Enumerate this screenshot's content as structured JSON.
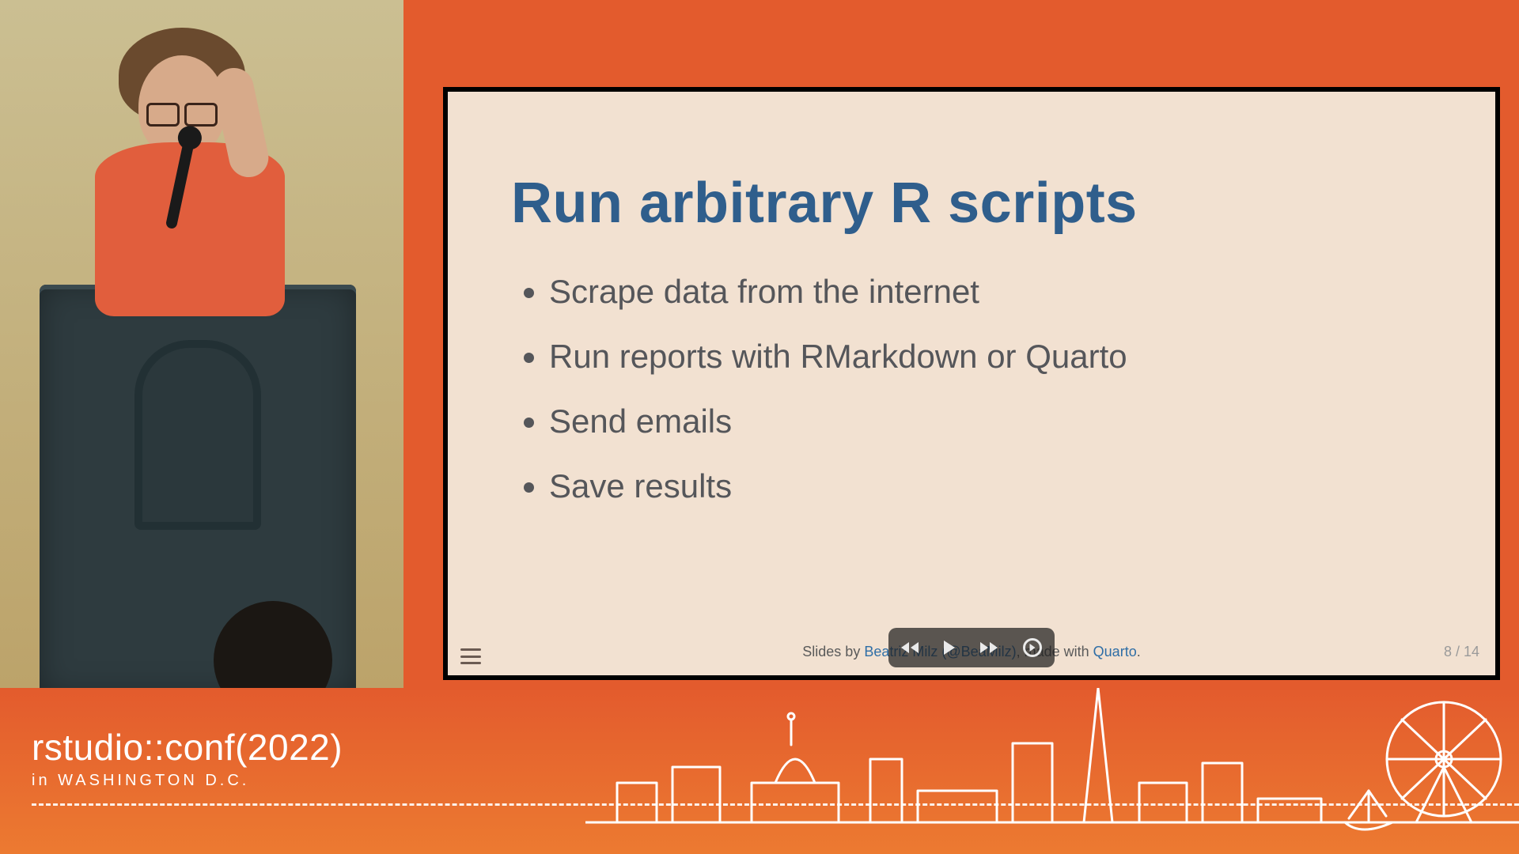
{
  "slide": {
    "title": "Run arbitrary R scripts",
    "bullets": [
      "Scrape data from the internet",
      "Run reports with RMarkdown or Quarto",
      "Send emails",
      "Save results"
    ],
    "footer": {
      "prefix": "Slides by ",
      "author": "Beatriz Milz (@BeaMilz)",
      "middle": ", made with ",
      "tool": "Quarto",
      "suffix": "."
    },
    "page": "8 / 14"
  },
  "banner": {
    "brand_bold": "rstudio",
    "brand_sep": "::",
    "brand_light": "conf(2022)",
    "subtitle": "in WASHINGTON D.C."
  }
}
